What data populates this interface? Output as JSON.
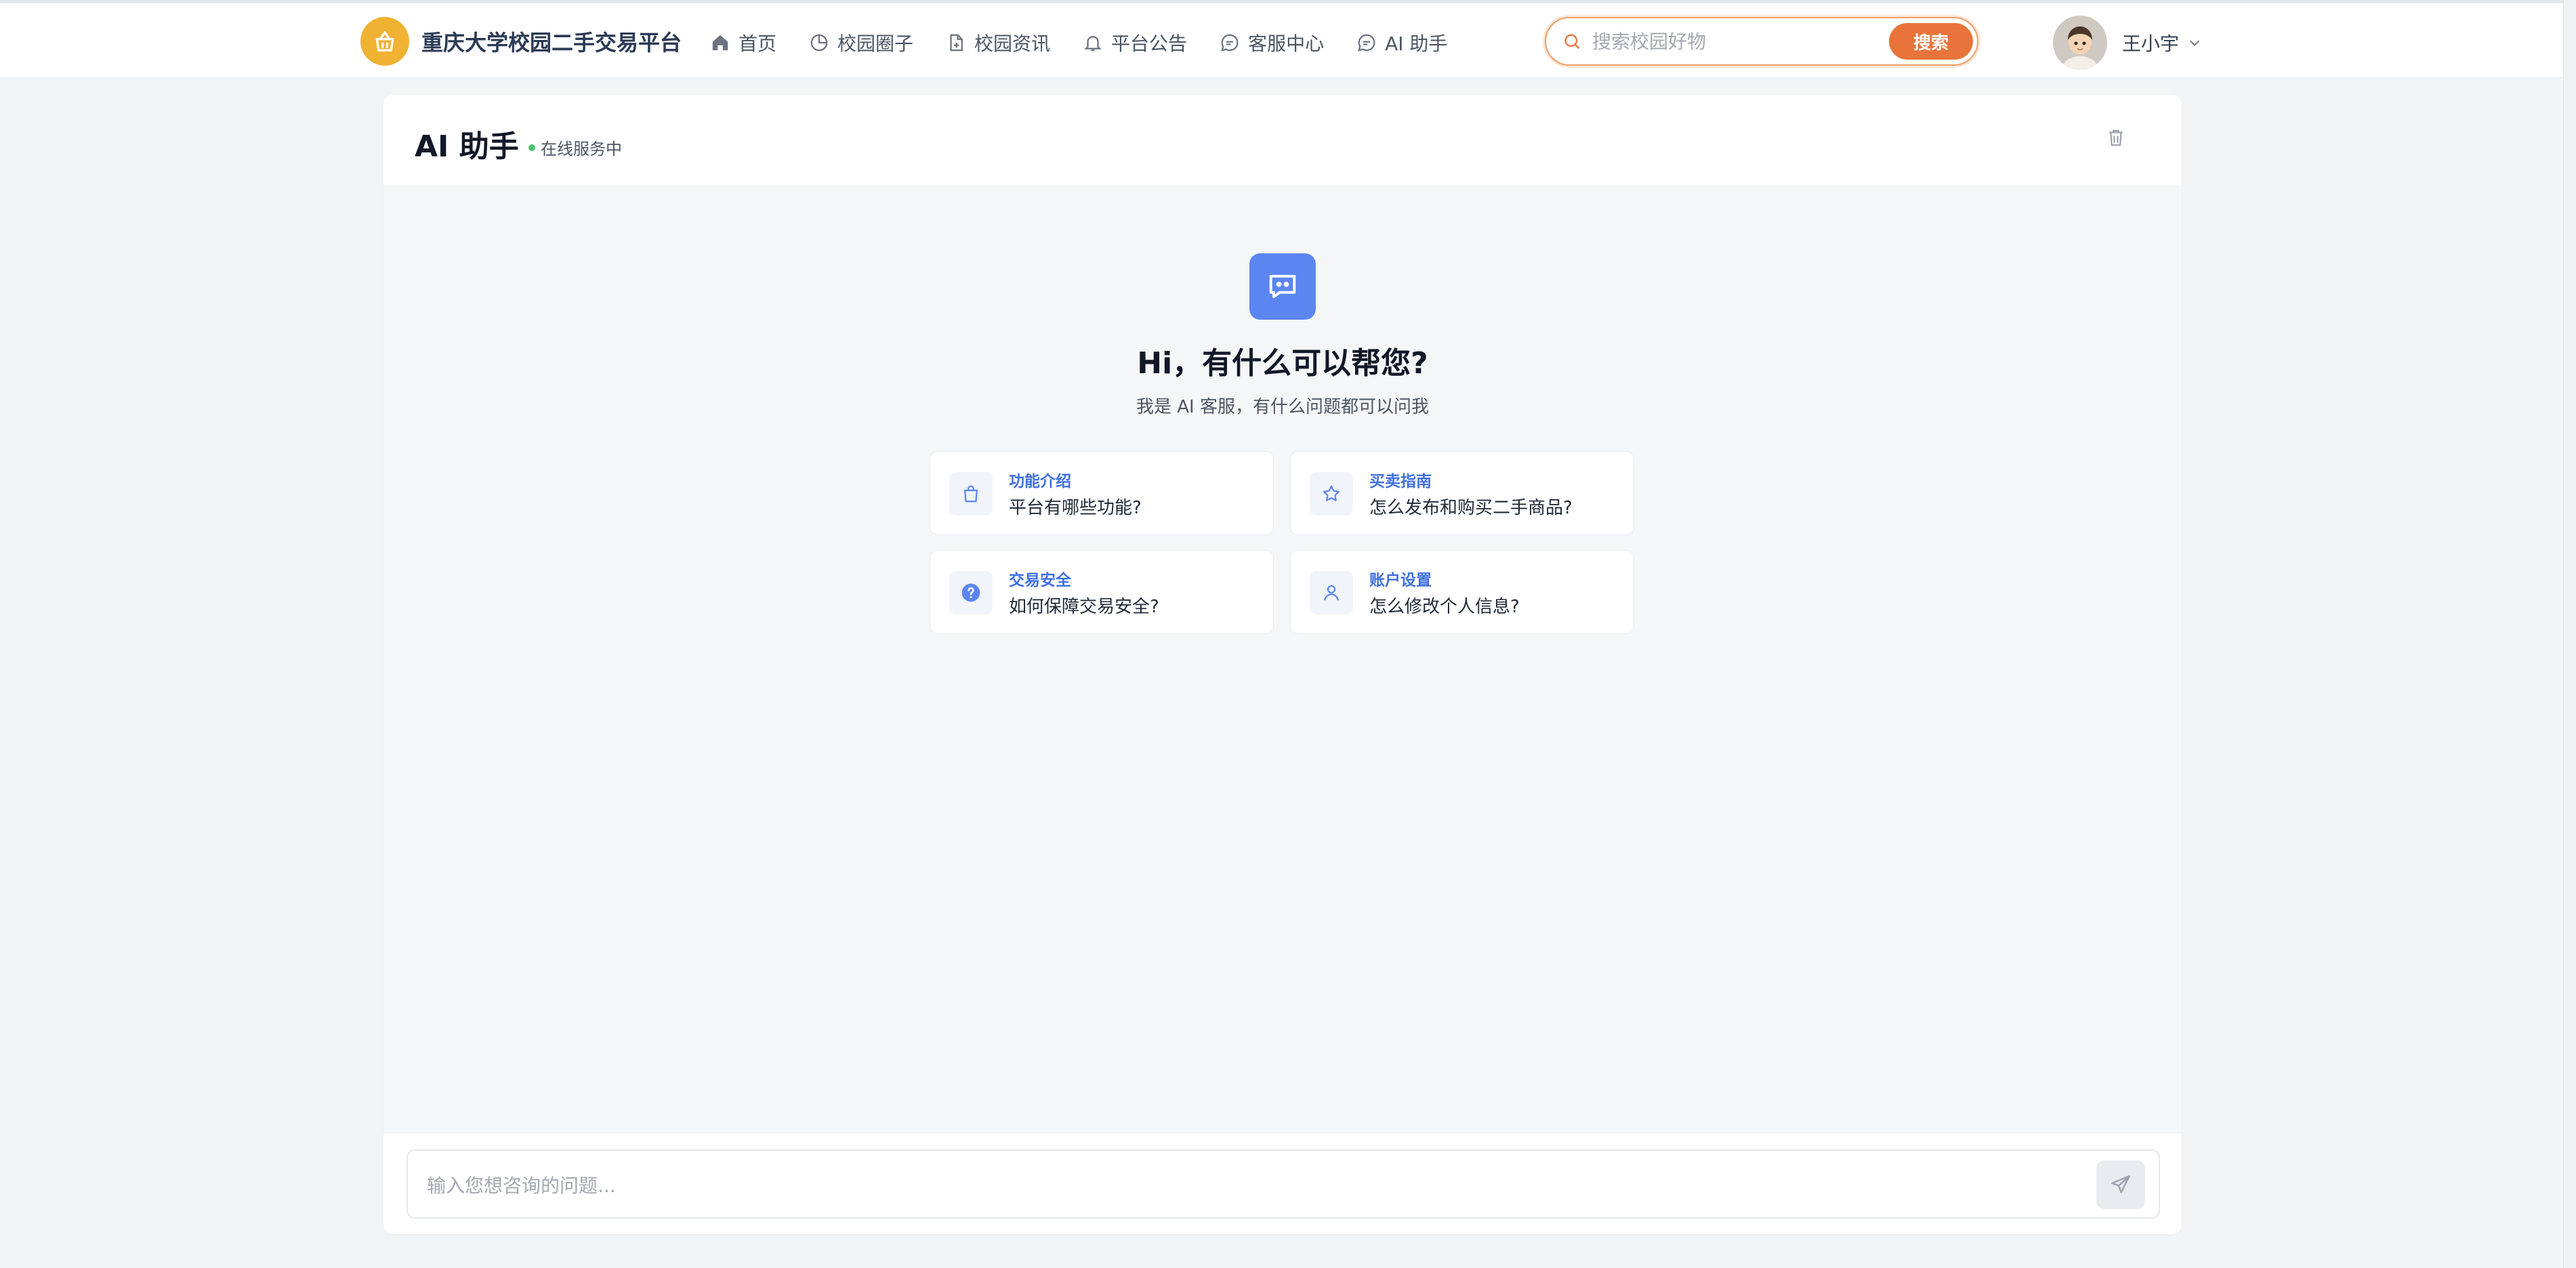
{
  "brand": {
    "title": "重庆大学校园二手交易平台",
    "logo_icon": "shopping-basket-icon",
    "logo_color": "#f0b233"
  },
  "nav": {
    "items": [
      {
        "label": "首页",
        "icon": "home-icon"
      },
      {
        "label": "校园圈子",
        "icon": "pie-chart-icon"
      },
      {
        "label": "校园资讯",
        "icon": "document-add-icon"
      },
      {
        "label": "平台公告",
        "icon": "bell-icon"
      },
      {
        "label": "客服中心",
        "icon": "chat-bubble-icon"
      },
      {
        "label": "AI 助手",
        "icon": "chat-bubble-icon"
      }
    ]
  },
  "search": {
    "placeholder": "搜索校园好物",
    "button_label": "搜索",
    "accent": "#e8743b"
  },
  "user": {
    "name": "王小宇"
  },
  "assistant": {
    "title": "AI 助手",
    "status": "在线服务中",
    "status_color": "#4cc26b",
    "greeting": "Hi，有什么可以帮您?",
    "subtitle": "我是 AI 客服，有什么问题都可以问我",
    "suggestions": [
      {
        "category": "功能介绍",
        "question": "平台有哪些功能?",
        "icon": "shopping-bag-icon"
      },
      {
        "category": "买卖指南",
        "question": "怎么发布和购买二手商品?",
        "icon": "star-icon"
      },
      {
        "category": "交易安全",
        "question": "如何保障交易安全?",
        "icon": "help-circle-icon"
      },
      {
        "category": "账户设置",
        "question": "怎么修改个人信息?",
        "icon": "user-icon"
      }
    ],
    "input_placeholder": "输入您想咨询的问题...",
    "accent": "#5b86f2"
  }
}
